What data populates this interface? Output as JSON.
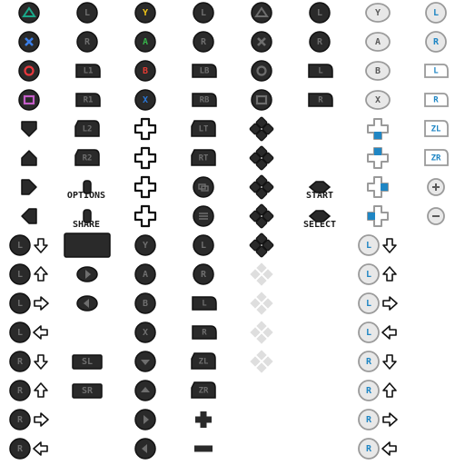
{
  "labels": {
    "options": "OPTIONS",
    "share": "SHARE",
    "start": "START",
    "select": "SELECT"
  },
  "colors": {
    "dark": "#2a2a2a",
    "outline": "#111111",
    "glyph": "#6e6e6e",
    "light_fill": "#e8e8e8",
    "light_outline": "#9a9a9a",
    "blue": "#1f86c4",
    "ps_triangle": "#1aa889",
    "ps_cross": "#3a7ee8",
    "ps_circle": "#e8383d",
    "ps_square": "#c45ec8",
    "xbox_y": "#f2c618",
    "xbox_a": "#37b24a",
    "xbox_b": "#e23b33",
    "xbox_x": "#2a78d8"
  },
  "glyph_texts": {
    "l": "L",
    "r": "R",
    "l1": "L1",
    "r1": "R1",
    "l2": "L2",
    "r2": "R2",
    "lb": "LB",
    "rb": "RB",
    "lt": "LT",
    "rt": "RT",
    "zl": "ZL",
    "zr": "ZR",
    "sl": "SL",
    "sr": "SR",
    "y": "Y",
    "a": "A",
    "b": "B",
    "x": "X"
  },
  "icons": [
    {
      "name": "ps-triangle-button-icon",
      "type": "round",
      "glyph": "tri",
      "tone": "ps_triangle",
      "col": 0,
      "row": 0
    },
    {
      "name": "ps-cross-button-icon",
      "type": "round",
      "glyph": "cross",
      "tone": "ps_cross",
      "col": 0,
      "row": 1
    },
    {
      "name": "ps-circle-button-icon",
      "type": "round",
      "glyph": "circle",
      "tone": "ps_circle",
      "col": 0,
      "row": 2
    },
    {
      "name": "ps-square-button-icon",
      "type": "round",
      "glyph": "square",
      "tone": "ps_square",
      "col": 0,
      "row": 3
    },
    {
      "name": "dpad-down-arrow-icon",
      "type": "arrow",
      "dir": "down",
      "col": 0,
      "row": 4
    },
    {
      "name": "dpad-up-arrow-icon",
      "type": "arrow",
      "dir": "up",
      "col": 0,
      "row": 5
    },
    {
      "name": "dpad-right-arrow-icon",
      "type": "arrow",
      "dir": "right",
      "col": 0,
      "row": 6
    },
    {
      "name": "dpad-left-arrow-icon",
      "type": "arrow",
      "dir": "left",
      "col": 0,
      "row": 7
    },
    {
      "name": "left-stick-icon",
      "type": "round",
      "text": "l",
      "col": 1,
      "row": 0
    },
    {
      "name": "right-stick-icon",
      "type": "round",
      "text": "r",
      "col": 1,
      "row": 1
    },
    {
      "name": "l1-bumper-icon",
      "type": "bumper",
      "text": "l1",
      "col": 1,
      "row": 2
    },
    {
      "name": "r1-bumper-icon",
      "type": "bumper",
      "text": "r1",
      "col": 1,
      "row": 3
    },
    {
      "name": "l2-trigger-icon",
      "type": "trigger",
      "text": "l2",
      "col": 1,
      "row": 4
    },
    {
      "name": "r2-trigger-icon",
      "type": "trigger",
      "text": "r2",
      "col": 1,
      "row": 5
    },
    {
      "name": "options-button-icon",
      "type": "pill",
      "col": 1,
      "row": 6
    },
    {
      "name": "share-button-icon",
      "type": "pill",
      "col": 1,
      "row": 7
    },
    {
      "name": "xbox-y-button-icon",
      "type": "round",
      "text": "y",
      "tone": "xbox_y",
      "col": 2,
      "row": 0
    },
    {
      "name": "xbox-a-button-icon",
      "type": "round",
      "text": "a",
      "tone": "xbox_a",
      "col": 2,
      "row": 1
    },
    {
      "name": "xbox-b-button-icon",
      "type": "round",
      "text": "b",
      "tone": "xbox_b",
      "col": 2,
      "row": 2
    },
    {
      "name": "xbox-x-button-icon",
      "type": "round",
      "text": "x",
      "tone": "xbox_x",
      "col": 2,
      "row": 3
    },
    {
      "name": "dpad-up-icon",
      "type": "dpad",
      "col": 2,
      "row": 4
    },
    {
      "name": "dpad-down-icon",
      "type": "dpad",
      "col": 2,
      "row": 5
    },
    {
      "name": "dpad-left-icon",
      "type": "dpad",
      "col": 2,
      "row": 6
    },
    {
      "name": "dpad-right-icon",
      "type": "dpad",
      "col": 2,
      "row": 7
    },
    {
      "name": "xbox-left-stick-icon",
      "type": "round",
      "text": "l",
      "col": 3,
      "row": 0
    },
    {
      "name": "xbox-right-stick-icon",
      "type": "round",
      "text": "r",
      "col": 3,
      "row": 1
    },
    {
      "name": "lb-bumper-icon",
      "type": "bumper",
      "text": "lb",
      "col": 3,
      "row": 2
    },
    {
      "name": "rb-bumper-icon",
      "type": "bumper",
      "text": "rb",
      "col": 3,
      "row": 3
    },
    {
      "name": "lt-trigger-icon",
      "type": "trigger",
      "text": "lt",
      "col": 3,
      "row": 4
    },
    {
      "name": "rt-trigger-icon",
      "type": "trigger",
      "text": "rt",
      "col": 3,
      "row": 5
    },
    {
      "name": "xbox-view-button-icon",
      "type": "round",
      "glyph": "view",
      "col": 3,
      "row": 6
    },
    {
      "name": "xbox-menu-button-icon",
      "type": "round",
      "glyph": "menu",
      "col": 3,
      "row": 7
    },
    {
      "name": "ps-triangle-dark-icon",
      "type": "round",
      "glyph": "tri",
      "col": 4,
      "row": 0
    },
    {
      "name": "ps-cross-dark-icon",
      "type": "round",
      "glyph": "cross",
      "col": 4,
      "row": 1
    },
    {
      "name": "ps-circle-dark-icon",
      "type": "round",
      "glyph": "circle",
      "col": 4,
      "row": 2
    },
    {
      "name": "ps-square-dark-icon",
      "type": "round",
      "glyph": "square",
      "col": 4,
      "row": 3
    },
    {
      "name": "dpad-cluster-down-icon",
      "type": "cluster",
      "col": 4,
      "row": 4
    },
    {
      "name": "dpad-cluster-up-icon",
      "type": "cluster",
      "col": 4,
      "row": 5
    },
    {
      "name": "dpad-cluster-left-icon",
      "type": "cluster",
      "col": 4,
      "row": 6
    },
    {
      "name": "dpad-cluster-right-icon",
      "type": "cluster",
      "col": 4,
      "row": 7
    },
    {
      "name": "ps-left-stick-icon",
      "type": "round",
      "text": "l",
      "col": 5,
      "row": 0
    },
    {
      "name": "ps-right-stick-icon",
      "type": "round",
      "text": "r",
      "col": 5,
      "row": 1
    },
    {
      "name": "l-bumper-icon",
      "type": "bumper",
      "text": "l",
      "col": 5,
      "row": 2
    },
    {
      "name": "r-bumper-icon",
      "type": "bumper",
      "text": "r",
      "col": 5,
      "row": 3
    },
    {
      "name": "start-button-icon",
      "type": "diamond",
      "col": 5,
      "row": 6
    },
    {
      "name": "select-button-icon",
      "type": "diamond",
      "col": 5,
      "row": 7
    },
    {
      "name": "switch-y-button-icon",
      "type": "lround",
      "text": "y",
      "col": 6,
      "row": 0
    },
    {
      "name": "switch-a-button-icon",
      "type": "lround",
      "text": "a",
      "col": 6,
      "row": 1
    },
    {
      "name": "switch-b-button-icon",
      "type": "lround",
      "text": "b",
      "col": 6,
      "row": 2
    },
    {
      "name": "switch-x-button-icon",
      "type": "lround",
      "text": "x",
      "col": 6,
      "row": 3
    },
    {
      "name": "switch-dpad-down-icon",
      "type": "ldpad",
      "dir": "down",
      "col": 6,
      "row": 4
    },
    {
      "name": "switch-dpad-up-icon",
      "type": "ldpad",
      "dir": "up",
      "col": 6,
      "row": 5
    },
    {
      "name": "switch-dpad-right-icon",
      "type": "ldpad",
      "dir": "right",
      "col": 6,
      "row": 6
    },
    {
      "name": "switch-dpad-left-icon",
      "type": "ldpad",
      "dir": "left",
      "col": 6,
      "row": 7
    },
    {
      "name": "switch-left-stick-icon",
      "type": "lstick",
      "text": "l",
      "col": 7,
      "row": 0
    },
    {
      "name": "switch-right-stick-icon",
      "type": "lstick",
      "text": "r",
      "col": 7,
      "row": 1
    },
    {
      "name": "switch-l-button-icon",
      "type": "lbumper",
      "text": "l",
      "col": 7,
      "row": 2
    },
    {
      "name": "switch-r-button-icon",
      "type": "lbumper",
      "text": "r",
      "col": 7,
      "row": 3
    },
    {
      "name": "switch-zl-trigger-icon",
      "type": "ltrigger",
      "text": "zl",
      "col": 7,
      "row": 4
    },
    {
      "name": "switch-zr-trigger-icon",
      "type": "ltrigger",
      "text": "zr",
      "col": 7,
      "row": 5
    },
    {
      "name": "switch-plus-button-icon",
      "type": "lcirc",
      "glyph": "plus",
      "col": 7,
      "row": 6
    },
    {
      "name": "switch-minus-button-icon",
      "type": "lcirc",
      "glyph": "minus",
      "col": 7,
      "row": 7
    },
    {
      "name": "left-stick-down-icon",
      "type": "stickarrow",
      "text": "l",
      "dir": "down",
      "col": 0,
      "row": 8
    },
    {
      "name": "left-stick-up-icon",
      "type": "stickarrow",
      "text": "l",
      "dir": "up",
      "col": 0,
      "row": 9
    },
    {
      "name": "left-stick-right-icon",
      "type": "stickarrow",
      "text": "l",
      "dir": "right",
      "col": 0,
      "row": 10
    },
    {
      "name": "left-stick-left-icon",
      "type": "stickarrow",
      "text": "l",
      "dir": "left",
      "col": 0,
      "row": 11
    },
    {
      "name": "right-stick-down-icon",
      "type": "stickarrow",
      "text": "r",
      "dir": "down",
      "col": 0,
      "row": 12
    },
    {
      "name": "right-stick-up-icon",
      "type": "stickarrow",
      "text": "r",
      "dir": "up",
      "col": 0,
      "row": 13
    },
    {
      "name": "right-stick-right-icon",
      "type": "stickarrow",
      "text": "r",
      "dir": "right",
      "col": 0,
      "row": 14
    },
    {
      "name": "right-stick-left-icon",
      "type": "stickarrow",
      "text": "r",
      "dir": "left",
      "col": 0,
      "row": 15
    },
    {
      "name": "touchpad-icon",
      "type": "touchpad",
      "col": 1,
      "row": 8
    },
    {
      "name": "joycon-right-side-icon",
      "type": "sideoval",
      "glyph": "right",
      "col": 1,
      "row": 9
    },
    {
      "name": "joycon-left-side-icon",
      "type": "sideoval",
      "glyph": "left",
      "col": 1,
      "row": 10
    },
    {
      "name": "sl-button-icon",
      "type": "rect",
      "text": "sl",
      "col": 1,
      "row": 12
    },
    {
      "name": "sr-button-icon",
      "type": "rect",
      "text": "sr",
      "col": 1,
      "row": 13
    },
    {
      "name": "y-button-outline-icon",
      "type": "round",
      "text": "y",
      "col": 2,
      "row": 8
    },
    {
      "name": "a-button-outline-icon",
      "type": "round",
      "text": "a",
      "col": 2,
      "row": 9
    },
    {
      "name": "b-button-outline-icon",
      "type": "round",
      "text": "b",
      "col": 2,
      "row": 10
    },
    {
      "name": "x-button-outline-icon",
      "type": "round",
      "text": "x",
      "col": 2,
      "row": 11
    },
    {
      "name": "dpad-down-button-icon",
      "type": "round",
      "glyph": "down",
      "col": 2,
      "row": 12
    },
    {
      "name": "dpad-up-button-icon",
      "type": "round",
      "glyph": "up",
      "col": 2,
      "row": 13
    },
    {
      "name": "dpad-right-button-icon",
      "type": "round",
      "glyph": "right",
      "col": 2,
      "row": 14
    },
    {
      "name": "dpad-left-button-icon",
      "type": "round",
      "glyph": "left",
      "col": 2,
      "row": 15
    },
    {
      "name": "stick-left-icon",
      "type": "round",
      "text": "l",
      "col": 3,
      "row": 8
    },
    {
      "name": "stick-right-icon",
      "type": "round",
      "text": "r",
      "col": 3,
      "row": 9
    },
    {
      "name": "joycon-l-button-icon",
      "type": "bumper",
      "text": "l",
      "col": 3,
      "row": 10
    },
    {
      "name": "joycon-r-button-icon",
      "type": "bumper",
      "text": "r",
      "col": 3,
      "row": 11
    },
    {
      "name": "joycon-zl-trigger-icon",
      "type": "trigger",
      "text": "zl",
      "col": 3,
      "row": 12
    },
    {
      "name": "joycon-zr-trigger-icon",
      "type": "trigger",
      "text": "zr",
      "col": 3,
      "row": 13
    },
    {
      "name": "plus-button-icon",
      "type": "plus",
      "col": 3,
      "row": 14
    },
    {
      "name": "minus-button-icon",
      "type": "minus",
      "col": 3,
      "row": 15
    },
    {
      "name": "dpad-cluster-icon",
      "type": "cluster",
      "col": 4,
      "row": 8
    },
    {
      "name": "dpad-cluster-faded-icon",
      "type": "cfaded",
      "col": 4,
      "row": 9
    },
    {
      "name": "dpad-cluster-faded-icon",
      "type": "cfaded",
      "col": 4,
      "row": 10
    },
    {
      "name": "dpad-cluster-faded-icon",
      "type": "cfaded",
      "col": 4,
      "row": 11
    },
    {
      "name": "dpad-cluster-faded-icon",
      "type": "cfaded",
      "col": 4,
      "row": 12
    },
    {
      "name": "light-left-stick-down-icon",
      "type": "lstickarrow",
      "text": "l",
      "dir": "down",
      "col": 6,
      "row": 8
    },
    {
      "name": "light-left-stick-up-icon",
      "type": "lstickarrow",
      "text": "l",
      "dir": "up",
      "col": 6,
      "row": 9
    },
    {
      "name": "light-left-stick-right-icon",
      "type": "lstickarrow",
      "text": "l",
      "dir": "right",
      "col": 6,
      "row": 10
    },
    {
      "name": "light-left-stick-left-icon",
      "type": "lstickarrow",
      "text": "l",
      "dir": "left",
      "col": 6,
      "row": 11
    },
    {
      "name": "light-right-stick-down-icon",
      "type": "lstickarrow",
      "text": "r",
      "dir": "down",
      "col": 6,
      "row": 12
    },
    {
      "name": "light-right-stick-up-icon",
      "type": "lstickarrow",
      "text": "r",
      "dir": "up",
      "col": 6,
      "row": 13
    },
    {
      "name": "light-right-stick-right-icon",
      "type": "lstickarrow",
      "text": "r",
      "dir": "right",
      "col": 6,
      "row": 14
    },
    {
      "name": "light-right-stick-left-icon",
      "type": "lstickarrow",
      "text": "r",
      "dir": "left",
      "col": 6,
      "row": 15
    }
  ]
}
